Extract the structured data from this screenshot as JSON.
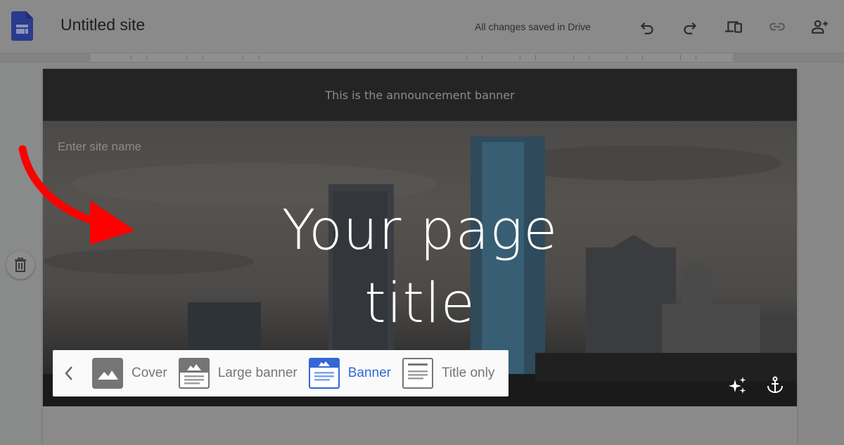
{
  "app": {
    "title": "Untitled site",
    "status": "All changes saved in Drive"
  },
  "toolbar": {
    "icons": [
      "undo-icon",
      "redo-icon",
      "preview-devices-icon",
      "link-icon",
      "share-add-person-icon"
    ]
  },
  "page": {
    "announcement": "This is the announcement banner",
    "site_name_placeholder": "Enter site name",
    "title_line1": "Your page",
    "title_line2": "title"
  },
  "layout_bar": {
    "options": [
      {
        "label": "Cover",
        "active": false
      },
      {
        "label": "Large banner",
        "active": false
      },
      {
        "label": "Banner",
        "active": true
      },
      {
        "label": "Title only",
        "active": false
      }
    ]
  },
  "colors": {
    "accent": "#3367d6",
    "arrow": "#ff0000",
    "logo": "#2a3a8c"
  }
}
